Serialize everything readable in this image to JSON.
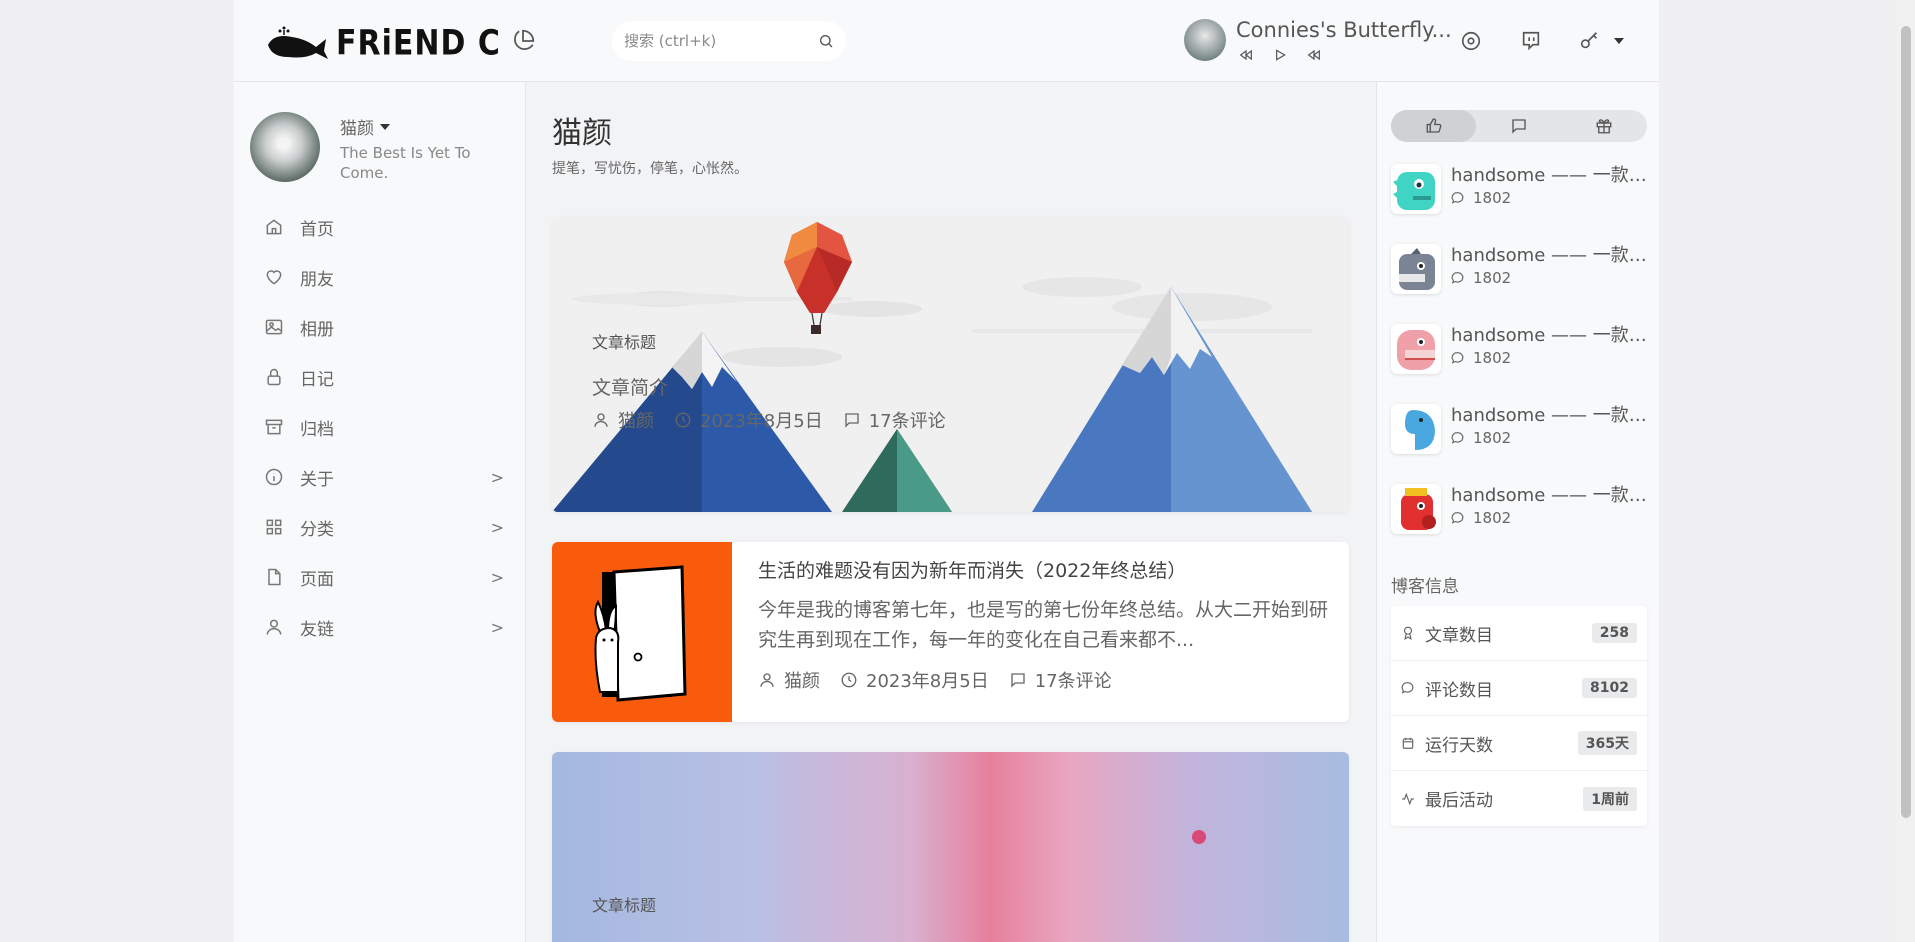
{
  "header": {
    "logo_text": "FRiEND C",
    "search_placeholder": "搜索 (ctrl+k)",
    "player_song": "Connies's Butterfly..."
  },
  "profile": {
    "name": "猫颜",
    "motto": "The Best Is Yet To Come."
  },
  "nav": {
    "items": [
      {
        "label": "首页",
        "icon": "home-icon",
        "has_arrow": false
      },
      {
        "label": "朋友",
        "icon": "heart-icon",
        "has_arrow": false
      },
      {
        "label": "相册",
        "icon": "image-icon",
        "has_arrow": false
      },
      {
        "label": "日记",
        "icon": "lock-icon",
        "has_arrow": false
      },
      {
        "label": "归档",
        "icon": "archive-icon",
        "has_arrow": false
      },
      {
        "label": "关于",
        "icon": "info-icon",
        "has_arrow": true
      },
      {
        "label": "分类",
        "icon": "grid-icon",
        "has_arrow": true
      },
      {
        "label": "页面",
        "icon": "file-icon",
        "has_arrow": true
      },
      {
        "label": "友链",
        "icon": "user-icon",
        "has_arrow": true
      }
    ],
    "arrow": ">"
  },
  "main": {
    "title": "猫颜",
    "subtitle": "提笔，写忧伤，停笔，心怅然。",
    "posts": [
      {
        "title": "文章标题",
        "desc": "文章简介",
        "author": "猫颜",
        "date": "2023年8月5日",
        "comments": "17条评论"
      },
      {
        "title": "生活的难题没有因为新年而消失（2022年终总结）",
        "desc": "今年是我的博客第七年，也是写的第七份年终总结。从大二开始到研究生再到现在工作，每一年的变化在自己看来都不...",
        "author": "猫颜",
        "date": "2023年8月5日",
        "comments": "17条评论"
      },
      {
        "title": "文章标题"
      }
    ]
  },
  "right": {
    "tabs": [
      "thumbs-up-icon",
      "comment-icon",
      "gift-icon"
    ],
    "list": [
      {
        "title": "handsome —— 一款typecho主题",
        "count": "1802",
        "color": "#3fd4c4"
      },
      {
        "title": "handsome —— 一款typecho主题",
        "count": "1802",
        "color": "#7b8494"
      },
      {
        "title": "handsome —— 一款typecho主题",
        "count": "1802",
        "color": "#f0a0a8"
      },
      {
        "title": "handsome —— 一款typecho主题",
        "count": "1802",
        "color": "#4aa8e0"
      },
      {
        "title": "handsome —— 一款typecho主题",
        "count": "1802",
        "color": "#e03030"
      }
    ],
    "blog_info_title": "博客信息",
    "blog_info": [
      {
        "label": "文章数目",
        "value": "258",
        "icon": "award-icon"
      },
      {
        "label": "评论数目",
        "value": "8102",
        "icon": "comment-icon"
      },
      {
        "label": "运行天数",
        "value": "365天",
        "icon": "calendar-icon"
      },
      {
        "label": "最后活动",
        "value": "1周前",
        "icon": "activity-icon"
      }
    ]
  },
  "colors": {
    "accent_orange": "#f95b0c",
    "mountain_blue": "#4a78c0",
    "balloon_red": "#d03030"
  }
}
